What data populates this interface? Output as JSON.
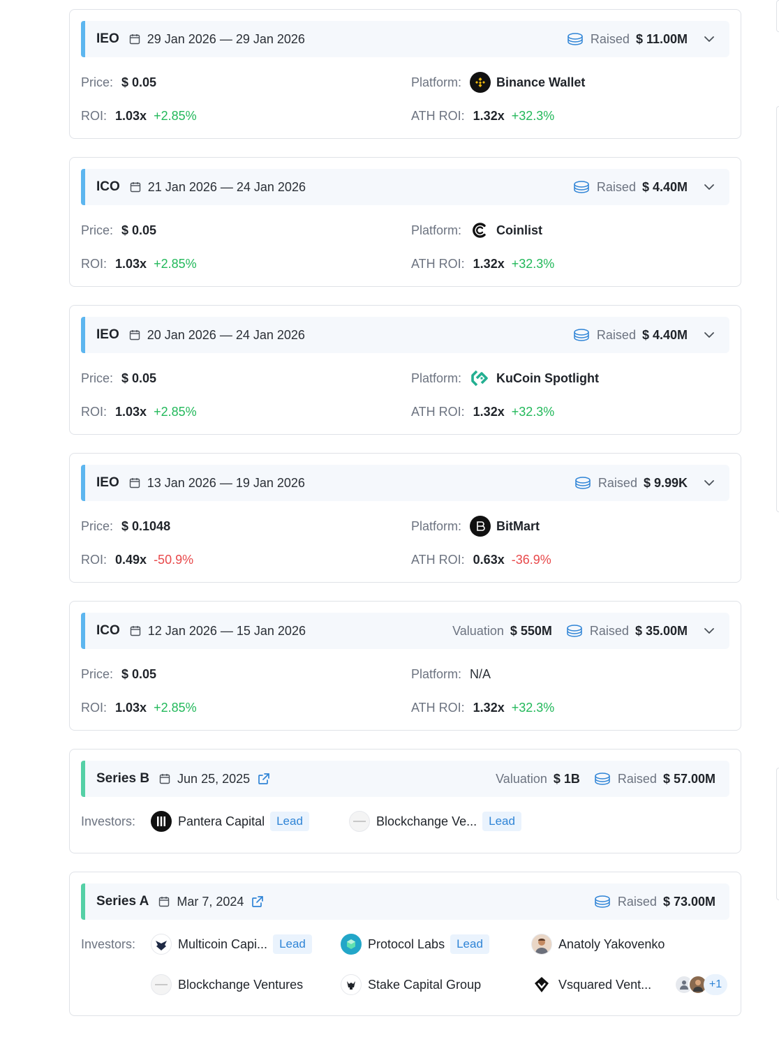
{
  "rounds": [
    {
      "type": "IEO",
      "dates": "29 Jan 2026 — 29 Jan 2026",
      "raised_label": "Raised",
      "raised": "$ 11.00M",
      "price_label": "Price:",
      "price": "$ 0.05",
      "platform_label": "Platform:",
      "platform": "Binance Wallet",
      "roi_label": "ROI:",
      "roi": "1.03x",
      "roi_pct": "+2.85%",
      "ath_label": "ATH ROI:",
      "ath_roi": "1.32x",
      "ath_pct": "+32.3%"
    },
    {
      "type": "ICO",
      "dates": "21 Jan 2026 — 24 Jan 2026",
      "raised_label": "Raised",
      "raised": "$ 4.40M",
      "price_label": "Price:",
      "price": "$ 0.05",
      "platform_label": "Platform:",
      "platform": "Coinlist",
      "roi_label": "ROI:",
      "roi": "1.03x",
      "roi_pct": "+2.85%",
      "ath_label": "ATH ROI:",
      "ath_roi": "1.32x",
      "ath_pct": "+32.3%"
    },
    {
      "type": "IEO",
      "dates": "20 Jan 2026 — 24 Jan 2026",
      "raised_label": "Raised",
      "raised": "$ 4.40M",
      "price_label": "Price:",
      "price": "$ 0.05",
      "platform_label": "Platform:",
      "platform": "KuCoin Spotlight",
      "roi_label": "ROI:",
      "roi": "1.03x",
      "roi_pct": "+2.85%",
      "ath_label": "ATH ROI:",
      "ath_roi": "1.32x",
      "ath_pct": "+32.3%"
    },
    {
      "type": "IEO",
      "dates": "13 Jan 2026 — 19 Jan 2026",
      "raised_label": "Raised",
      "raised": "$ 9.99K",
      "price_label": "Price:",
      "price": "$ 0.1048",
      "platform_label": "Platform:",
      "platform": "BitMart",
      "roi_label": "ROI:",
      "roi": "0.49x",
      "roi_pct": "-50.9%",
      "ath_label": "ATH ROI:",
      "ath_roi": "0.63x",
      "ath_pct": "-36.9%"
    },
    {
      "type": "ICO",
      "dates": "12 Jan 2026 — 15 Jan 2026",
      "valuation_label": "Valuation",
      "valuation": "$ 550M",
      "raised_label": "Raised",
      "raised": "$ 35.00M",
      "price_label": "Price:",
      "price": "$ 0.05",
      "platform_label": "Platform:",
      "platform": "N/A",
      "roi_label": "ROI:",
      "roi": "1.03x",
      "roi_pct": "+2.85%",
      "ath_label": "ATH ROI:",
      "ath_roi": "1.32x",
      "ath_pct": "+32.3%"
    }
  ],
  "series": [
    {
      "type": "Series B",
      "date": "Jun 25, 2025",
      "valuation_label": "Valuation",
      "valuation": "$ 1B",
      "raised_label": "Raised",
      "raised": "$ 57.00M",
      "investors_label": "Investors:",
      "investors": [
        {
          "name": "Pantera Capital",
          "badge": "Lead"
        },
        {
          "name": "Blockchange Ve...",
          "badge": "Lead"
        }
      ]
    },
    {
      "type": "Series A",
      "date": "Mar 7, 2024",
      "raised_label": "Raised",
      "raised": "$ 73.00M",
      "investors_label": "Investors:",
      "investors": [
        {
          "name": "Multicoin Capi...",
          "badge": "Lead"
        },
        {
          "name": "Protocol Labs",
          "badge": "Lead"
        },
        {
          "name": "Anatoly Yakovenko"
        },
        {
          "name": "Blockchange Ventures"
        },
        {
          "name": "Stake Capital Group"
        },
        {
          "name": "Vsquared Vent..."
        }
      ],
      "more_count": "+1"
    }
  ],
  "colors": {
    "positive": "#22b85a",
    "negative": "#e8484a",
    "accent": "#2f84d6",
    "ico_bar": "#5db6ef",
    "series_bar": "#55d0a6"
  }
}
